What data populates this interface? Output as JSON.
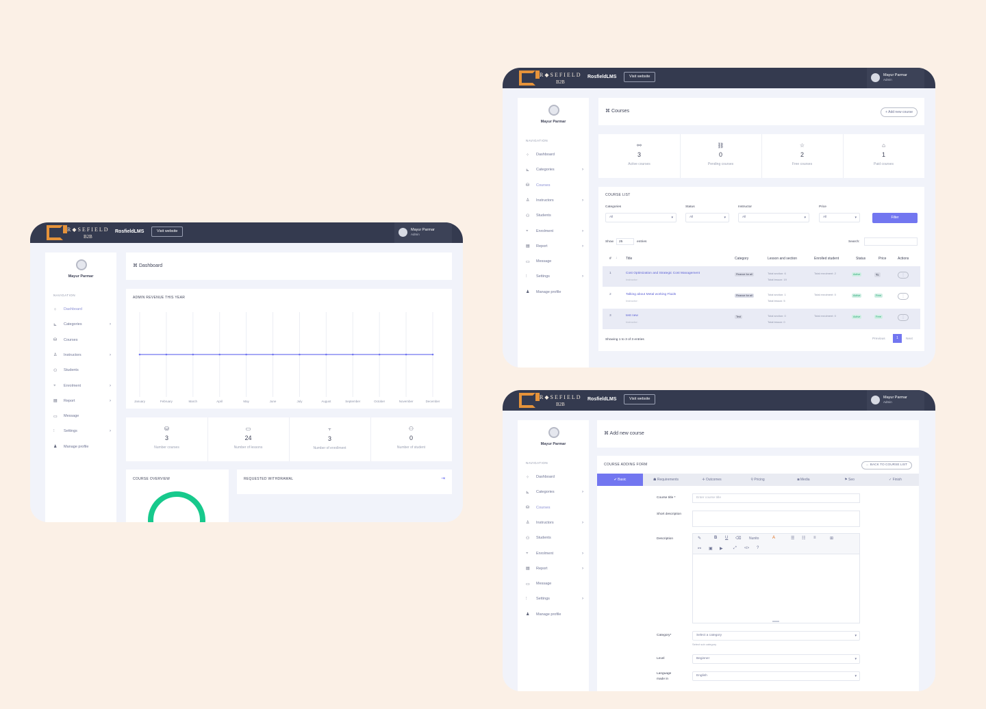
{
  "app": {
    "brand": "R◆SEFIELD",
    "b2b": "B2B",
    "name": "RosfieldLMS",
    "visit": "Visit website"
  },
  "user": {
    "name": "Mayur Parmar",
    "role": "Admin"
  },
  "nav": {
    "heading": "NAVIGATION",
    "items": [
      {
        "label": "Dashboard",
        "icon": "dashboard-icon",
        "glyph": "⁘",
        "has_children": false
      },
      {
        "label": "Categories",
        "icon": "categories-icon",
        "glyph": "⊾",
        "has_children": true
      },
      {
        "label": "Courses",
        "icon": "courses-icon",
        "glyph": "⛁",
        "has_children": false
      },
      {
        "label": "Instructors",
        "icon": "instructors-icon",
        "glyph": "♙",
        "has_children": true
      },
      {
        "label": "Students",
        "icon": "students-icon",
        "glyph": "⚇",
        "has_children": false
      },
      {
        "label": "Enrolment",
        "icon": "enrolment-icon",
        "glyph": "⫟",
        "has_children": true
      },
      {
        "label": "Report",
        "icon": "report-icon",
        "glyph": "▤",
        "has_children": true
      },
      {
        "label": "Message",
        "icon": "message-icon",
        "glyph": "▭",
        "has_children": false
      },
      {
        "label": "Settings",
        "icon": "settings-icon",
        "glyph": "⫶",
        "has_children": true
      },
      {
        "label": "Manage profile",
        "icon": "profile-icon",
        "glyph": "♟",
        "has_children": false
      }
    ]
  },
  "dashboard": {
    "title": "⌘ Dashboard",
    "revenue_title": "ADMIN REVENUE THIS YEAR",
    "stats": [
      {
        "icon": "basket-icon",
        "glyph": "⛁",
        "value": "3",
        "label": "Number courses"
      },
      {
        "icon": "video-icon",
        "glyph": "▭",
        "value": "24",
        "label": "Number of lessons"
      },
      {
        "icon": "hierarchy-icon",
        "glyph": "⫟",
        "value": "3",
        "label": "Number of enrollment"
      },
      {
        "icon": "students-icon",
        "glyph": "⚇",
        "value": "0",
        "label": "Number of student"
      }
    ],
    "overview_title": "COURSE OVERVIEW",
    "withdrawal_title": "REQUESTED WITHDRAWAL",
    "withdrawal_icon": "⇥"
  },
  "chart_data": {
    "type": "line",
    "title": "ADMIN REVENUE THIS YEAR",
    "categories": [
      "January",
      "February",
      "March",
      "April",
      "May",
      "June",
      "July",
      "August",
      "September",
      "October",
      "November",
      "December"
    ],
    "series": [
      {
        "values": [
          0,
          0,
          0,
          0,
          0,
          0,
          0,
          0,
          0,
          0,
          0,
          0
        ]
      }
    ],
    "ylim": [
      -1,
      1
    ],
    "grid": true,
    "color": "#7276f0"
  },
  "courses": {
    "title": "⌘ Courses",
    "add_button": "+ Add new course",
    "stats": [
      {
        "icon": "link-icon",
        "glyph": "⚯",
        "value": "3",
        "label": "Active courses"
      },
      {
        "icon": "pending-icon",
        "glyph": "⛓",
        "value": "0",
        "label": "Pending courses"
      },
      {
        "icon": "star-icon",
        "glyph": "☆",
        "value": "2",
        "label": "Free courses"
      },
      {
        "icon": "tag-icon",
        "glyph": "⌂",
        "value": "1",
        "label": "Paid courses"
      }
    ],
    "list_title": "COURSE LIST",
    "filters": [
      {
        "label": "Categories",
        "value": "All"
      },
      {
        "label": "Status",
        "value": "All"
      },
      {
        "label": "Instructor",
        "value": "All"
      },
      {
        "label": "Price",
        "value": "All"
      }
    ],
    "filter_button": "Filter",
    "show_label": "Show",
    "show_value": "25",
    "entries_label": "entries",
    "search_label": "Search:",
    "columns": [
      "#",
      "Title",
      "Category",
      "Lesson and section",
      "Enrolled student",
      "Status",
      "Price",
      "Actions"
    ],
    "rows": [
      {
        "num": "1",
        "title": "Cost Optimization and Strategic Cost Management",
        "instructor": "Instructor:",
        "category": "Finance for all",
        "sections": "Total section: 6",
        "lessons": "Total lesson: 19",
        "enrolled": "Total enrolment: 2",
        "status": "Active",
        "price": "₹5",
        "action": "⋮"
      },
      {
        "num": "2",
        "title": "Talking about Metal working Fluids",
        "instructor": "Instructor:",
        "category": "Finance for all",
        "sections": "Total section: 1",
        "lessons": "Total lesson: 5",
        "enrolled": "Total enrolment: 0",
        "status": "Active",
        "price": "Free",
        "action": "⋮"
      },
      {
        "num": "3",
        "title": "test new",
        "instructor": "Instructor:",
        "category": "Test",
        "sections": "Total section: 0",
        "lessons": "Total lesson: 0",
        "enrolled": "Total enrolment: 0",
        "status": "Active",
        "price": "Free",
        "action": "⋮"
      }
    ],
    "showing": "Showing 1 to 3 of 3 entries",
    "prev": "Previous",
    "page": "1",
    "next": "Next"
  },
  "add_course": {
    "title": "⌘ Add new course",
    "form_title": "COURSE ADDING FORM",
    "back_button": "← BACK TO COURSE LIST",
    "tabs": [
      "✔ Basic",
      "☗ Requirements",
      "✛ Outcomes",
      "⚲ Pricing",
      "◙ Media",
      "⚑ Seo",
      "✓ Finish"
    ],
    "course_title_label": "Course title *",
    "course_title_placeholder": "Enter course title",
    "short_desc_label": "Short description",
    "desc_label": "Description",
    "toolbar_font": "Nunito",
    "category_label": "Category*",
    "category_value": "Select a category",
    "category_hint": "Select sub category",
    "level_label": "Level",
    "level_value": "Beginner",
    "language_label": "Language made in",
    "language_value": "English"
  }
}
